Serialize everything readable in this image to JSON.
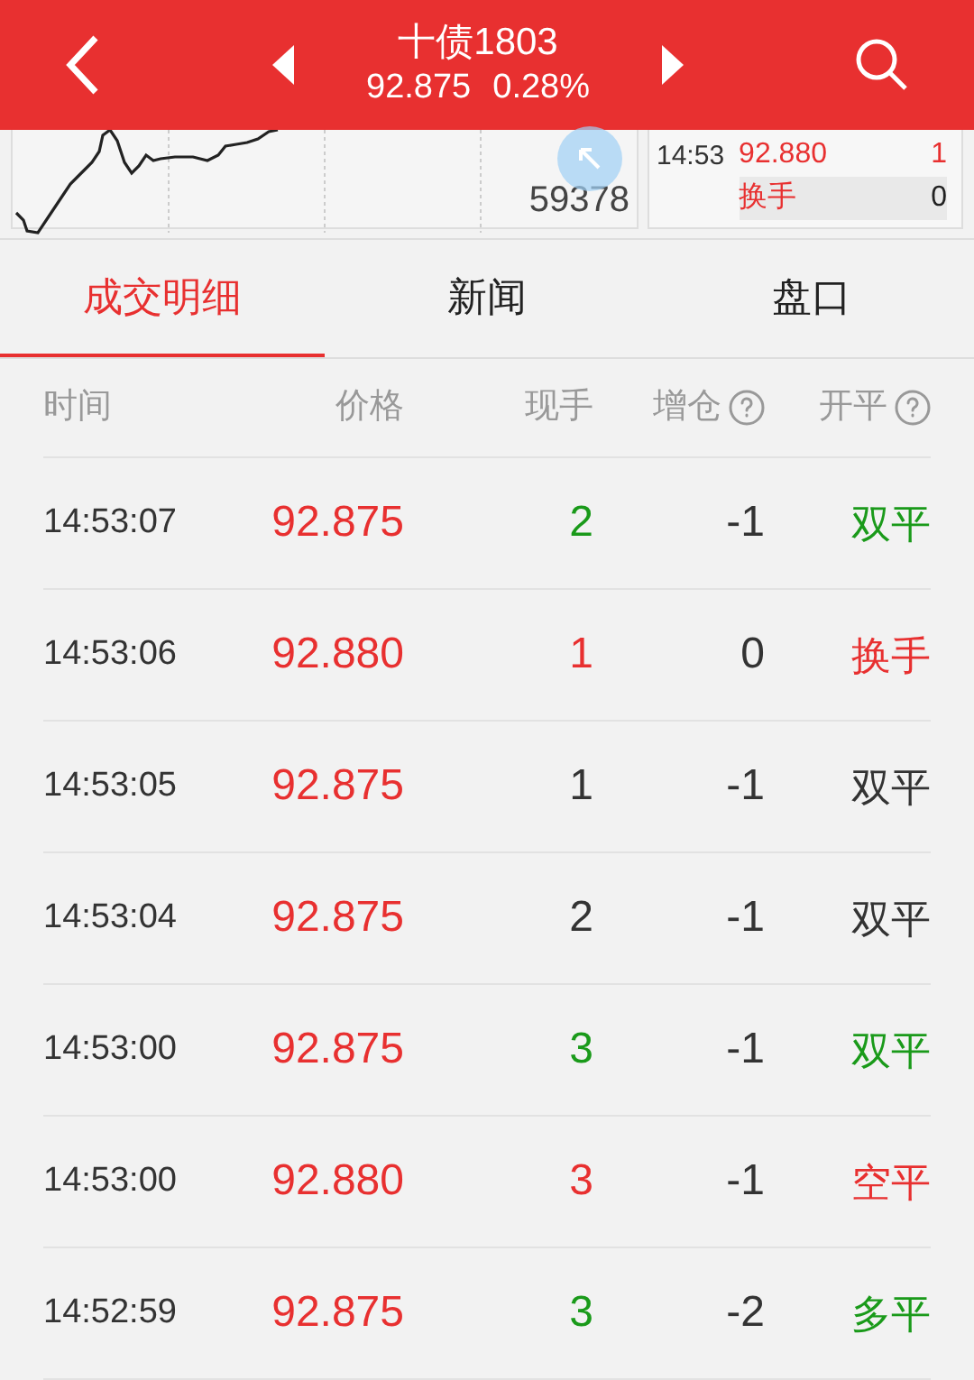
{
  "header": {
    "title": "十债1803",
    "price": "92.875",
    "change": "0.28%"
  },
  "mini_chart": {
    "volume_label": "59378"
  },
  "side_panel": {
    "time": "14:53",
    "price": "92.880",
    "volume": "1",
    "type": "换手",
    "type_value": "0"
  },
  "tabs": [
    {
      "label": "成交明细",
      "selected": true
    },
    {
      "label": "新闻",
      "selected": false
    },
    {
      "label": "盘口",
      "selected": false
    }
  ],
  "table": {
    "columns": [
      {
        "label": "时间",
        "help": false
      },
      {
        "label": "价格",
        "help": false
      },
      {
        "label": "现手",
        "help": false
      },
      {
        "label": "增仓",
        "help": true
      },
      {
        "label": "开平",
        "help": true
      }
    ],
    "rows": [
      {
        "time": "14:53:07",
        "price": "92.875",
        "volume": {
          "text": "2",
          "kind": "sell"
        },
        "oi": "-1",
        "type": {
          "text": "双平",
          "kind": "sell"
        }
      },
      {
        "time": "14:53:06",
        "price": "92.880",
        "volume": {
          "text": "1",
          "kind": "buy"
        },
        "oi": "0",
        "type": {
          "text": "换手",
          "kind": "buy"
        }
      },
      {
        "time": "14:53:05",
        "price": "92.875",
        "volume": {
          "text": "1",
          "kind": "neutral"
        },
        "oi": "-1",
        "type": {
          "text": "双平",
          "kind": "neutral"
        }
      },
      {
        "time": "14:53:04",
        "price": "92.875",
        "volume": {
          "text": "2",
          "kind": "neutral"
        },
        "oi": "-1",
        "type": {
          "text": "双平",
          "kind": "neutral"
        }
      },
      {
        "time": "14:53:00",
        "price": "92.875",
        "volume": {
          "text": "3",
          "kind": "sell"
        },
        "oi": "-1",
        "type": {
          "text": "双平",
          "kind": "sell"
        }
      },
      {
        "time": "14:53:00",
        "price": "92.880",
        "volume": {
          "text": "3",
          "kind": "buy"
        },
        "oi": "-1",
        "type": {
          "text": "空平",
          "kind": "buy"
        }
      },
      {
        "time": "14:52:59",
        "price": "92.875",
        "volume": {
          "text": "3",
          "kind": "sell"
        },
        "oi": "-2",
        "type": {
          "text": "多平",
          "kind": "sell"
        }
      }
    ]
  }
}
